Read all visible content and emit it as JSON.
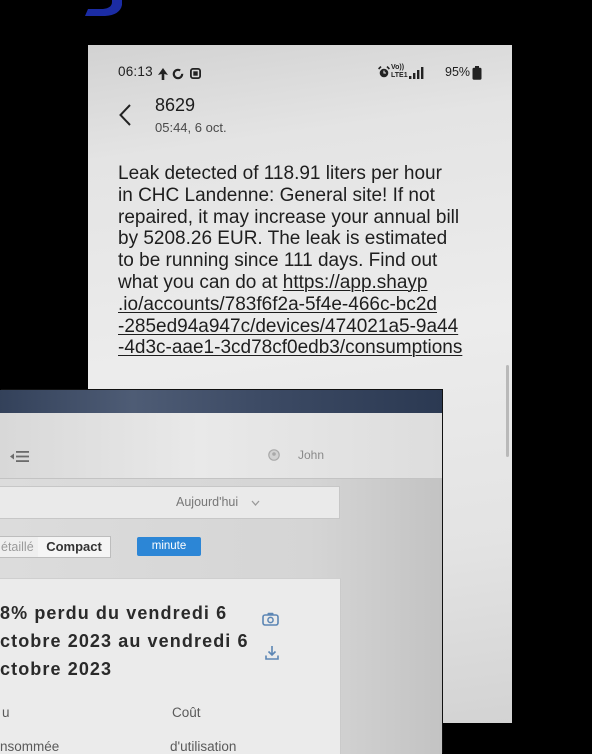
{
  "status_bar": {
    "time": "06:13",
    "volte_top": "Vo))",
    "volte_bottom": "LTE1",
    "battery": "95%",
    "icons": [
      "navigation-icon",
      "sync-icon",
      "gallery-icon",
      "alarm-icon",
      "signal-icon",
      "battery-icon"
    ]
  },
  "conversation": {
    "sender": "8629",
    "timestamp": "05:44, 6 oct."
  },
  "message": {
    "lines": [
      {
        "text": "Leak detected of 118.91 liters per hour"
      },
      {
        "text": "in CHC Landenne: General site! If not"
      },
      {
        "text": "repaired, it may increase your annual bill"
      },
      {
        "text": "by 5208.26 EUR. The leak is estimated"
      },
      {
        "text": "to be running since 111 days. Find out"
      },
      {
        "text": "what you can do at ",
        "link": "https://app.shayp"
      },
      {
        "link": ".io/accounts/783f6f2a-5f4e-466c-bc2d"
      },
      {
        "link": "-285ed94a947c/devices/474021a5-9a44"
      },
      {
        "link": "-4d3c-aae1-3cd78cf0edb3/consumptions"
      }
    ]
  },
  "dashboard": {
    "user_name": "John",
    "period_select": "Aujourd'hui",
    "view_tabs": [
      {
        "label": "étaillé"
      },
      {
        "label": "Compact"
      }
    ],
    "interval_button": "minute",
    "summary": [
      "8% perdu du vendredi 6",
      "ctobre 2023 au vendredi 6",
      "ctobre 2023"
    ],
    "columns": [
      {
        "line1": "u",
        "line2": "nsommée"
      },
      {
        "line1": "Coût",
        "line2": "d'utilisation"
      }
    ],
    "icons": [
      "menu-collapse-icon",
      "user-icon",
      "chevron-down-icon",
      "camera-icon",
      "download-icon"
    ]
  },
  "colors": {
    "background": "#000000",
    "logo_blue": "#1b2ca4",
    "message_text": "#1e1e1e",
    "button_blue": "#2c86d6",
    "icon_blue": "#5c86b4"
  }
}
